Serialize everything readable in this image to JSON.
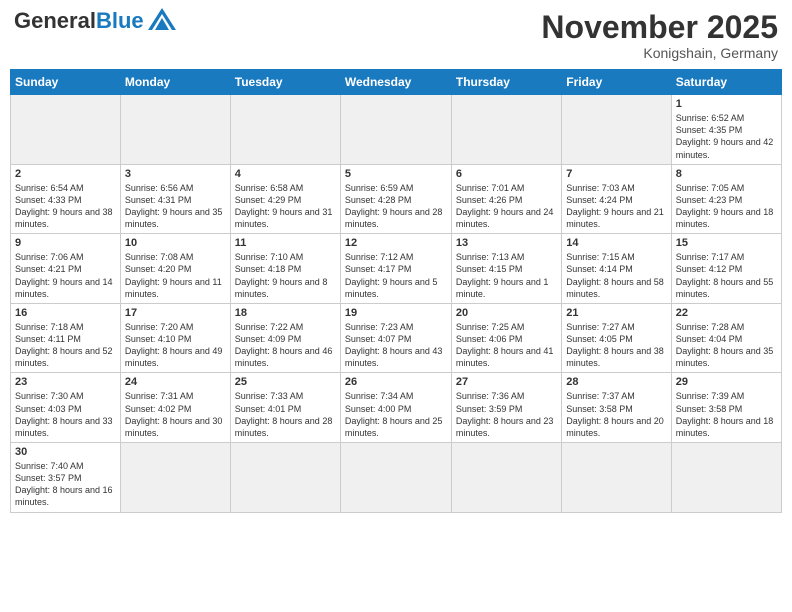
{
  "header": {
    "logo_general": "General",
    "logo_blue": "Blue",
    "month_title": "November 2025",
    "location": "Konigshain, Germany"
  },
  "weekdays": [
    "Sunday",
    "Monday",
    "Tuesday",
    "Wednesday",
    "Thursday",
    "Friday",
    "Saturday"
  ],
  "weeks": [
    [
      {
        "day": "",
        "empty": true
      },
      {
        "day": "",
        "empty": true
      },
      {
        "day": "",
        "empty": true
      },
      {
        "day": "",
        "empty": true
      },
      {
        "day": "",
        "empty": true
      },
      {
        "day": "",
        "empty": true
      },
      {
        "day": "1",
        "sunrise": "6:52 AM",
        "sunset": "4:35 PM",
        "daylight": "9 hours and 42 minutes."
      }
    ],
    [
      {
        "day": "2",
        "sunrise": "6:54 AM",
        "sunset": "4:33 PM",
        "daylight": "9 hours and 38 minutes."
      },
      {
        "day": "3",
        "sunrise": "6:56 AM",
        "sunset": "4:31 PM",
        "daylight": "9 hours and 35 minutes."
      },
      {
        "day": "4",
        "sunrise": "6:58 AM",
        "sunset": "4:29 PM",
        "daylight": "9 hours and 31 minutes."
      },
      {
        "day": "5",
        "sunrise": "6:59 AM",
        "sunset": "4:28 PM",
        "daylight": "9 hours and 28 minutes."
      },
      {
        "day": "6",
        "sunrise": "7:01 AM",
        "sunset": "4:26 PM",
        "daylight": "9 hours and 24 minutes."
      },
      {
        "day": "7",
        "sunrise": "7:03 AM",
        "sunset": "4:24 PM",
        "daylight": "9 hours and 21 minutes."
      },
      {
        "day": "8",
        "sunrise": "7:05 AM",
        "sunset": "4:23 PM",
        "daylight": "9 hours and 18 minutes."
      }
    ],
    [
      {
        "day": "9",
        "sunrise": "7:06 AM",
        "sunset": "4:21 PM",
        "daylight": "9 hours and 14 minutes."
      },
      {
        "day": "10",
        "sunrise": "7:08 AM",
        "sunset": "4:20 PM",
        "daylight": "9 hours and 11 minutes."
      },
      {
        "day": "11",
        "sunrise": "7:10 AM",
        "sunset": "4:18 PM",
        "daylight": "9 hours and 8 minutes."
      },
      {
        "day": "12",
        "sunrise": "7:12 AM",
        "sunset": "4:17 PM",
        "daylight": "9 hours and 5 minutes."
      },
      {
        "day": "13",
        "sunrise": "7:13 AM",
        "sunset": "4:15 PM",
        "daylight": "9 hours and 1 minute."
      },
      {
        "day": "14",
        "sunrise": "7:15 AM",
        "sunset": "4:14 PM",
        "daylight": "8 hours and 58 minutes."
      },
      {
        "day": "15",
        "sunrise": "7:17 AM",
        "sunset": "4:12 PM",
        "daylight": "8 hours and 55 minutes."
      }
    ],
    [
      {
        "day": "16",
        "sunrise": "7:18 AM",
        "sunset": "4:11 PM",
        "daylight": "8 hours and 52 minutes."
      },
      {
        "day": "17",
        "sunrise": "7:20 AM",
        "sunset": "4:10 PM",
        "daylight": "8 hours and 49 minutes."
      },
      {
        "day": "18",
        "sunrise": "7:22 AM",
        "sunset": "4:09 PM",
        "daylight": "8 hours and 46 minutes."
      },
      {
        "day": "19",
        "sunrise": "7:23 AM",
        "sunset": "4:07 PM",
        "daylight": "8 hours and 43 minutes."
      },
      {
        "day": "20",
        "sunrise": "7:25 AM",
        "sunset": "4:06 PM",
        "daylight": "8 hours and 41 minutes."
      },
      {
        "day": "21",
        "sunrise": "7:27 AM",
        "sunset": "4:05 PM",
        "daylight": "8 hours and 38 minutes."
      },
      {
        "day": "22",
        "sunrise": "7:28 AM",
        "sunset": "4:04 PM",
        "daylight": "8 hours and 35 minutes."
      }
    ],
    [
      {
        "day": "23",
        "sunrise": "7:30 AM",
        "sunset": "4:03 PM",
        "daylight": "8 hours and 33 minutes."
      },
      {
        "day": "24",
        "sunrise": "7:31 AM",
        "sunset": "4:02 PM",
        "daylight": "8 hours and 30 minutes."
      },
      {
        "day": "25",
        "sunrise": "7:33 AM",
        "sunset": "4:01 PM",
        "daylight": "8 hours and 28 minutes."
      },
      {
        "day": "26",
        "sunrise": "7:34 AM",
        "sunset": "4:00 PM",
        "daylight": "8 hours and 25 minutes."
      },
      {
        "day": "27",
        "sunrise": "7:36 AM",
        "sunset": "3:59 PM",
        "daylight": "8 hours and 23 minutes."
      },
      {
        "day": "28",
        "sunrise": "7:37 AM",
        "sunset": "3:58 PM",
        "daylight": "8 hours and 20 minutes."
      },
      {
        "day": "29",
        "sunrise": "7:39 AM",
        "sunset": "3:58 PM",
        "daylight": "8 hours and 18 minutes."
      }
    ],
    [
      {
        "day": "30",
        "sunrise": "7:40 AM",
        "sunset": "3:57 PM",
        "daylight": "8 hours and 16 minutes."
      },
      {
        "day": "",
        "empty": true
      },
      {
        "day": "",
        "empty": true
      },
      {
        "day": "",
        "empty": true
      },
      {
        "day": "",
        "empty": true
      },
      {
        "day": "",
        "empty": true
      },
      {
        "day": "",
        "empty": true
      }
    ]
  ]
}
